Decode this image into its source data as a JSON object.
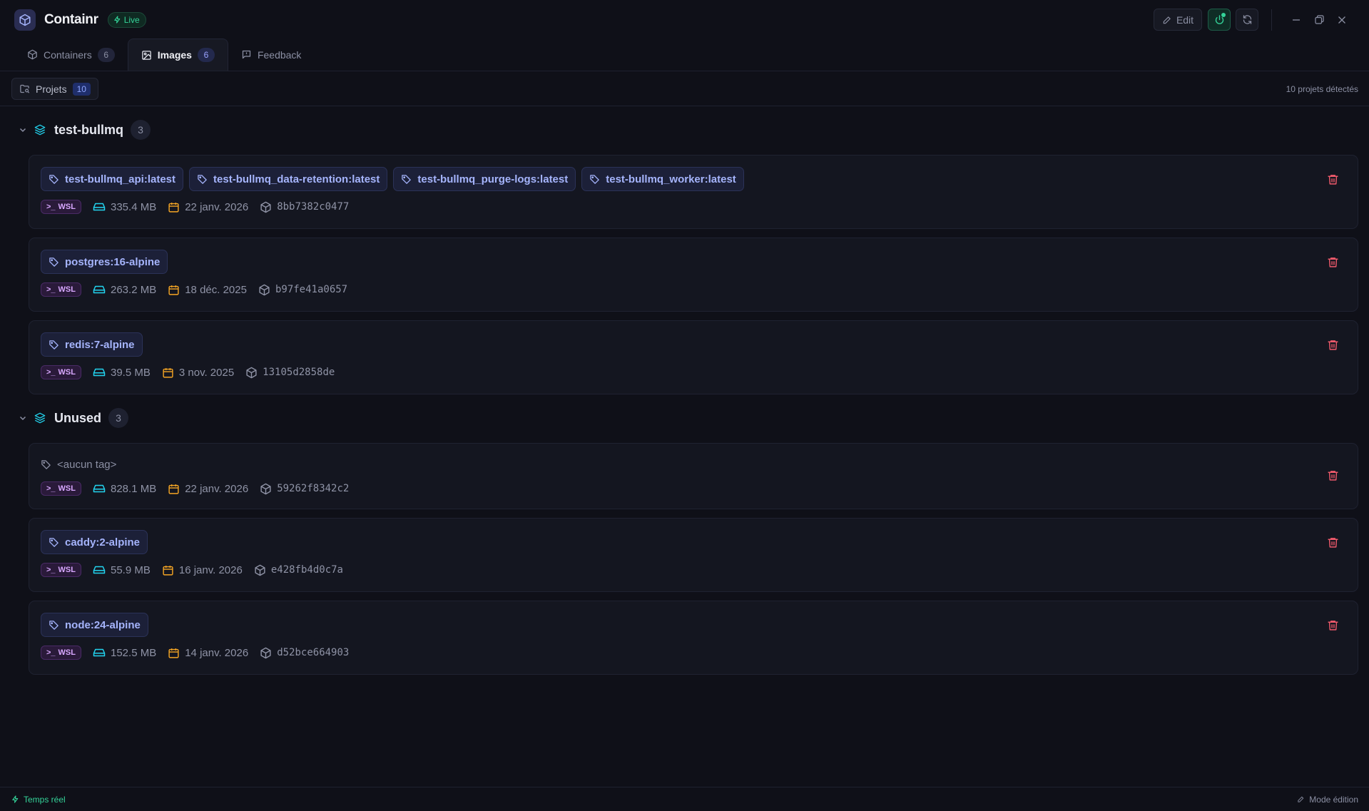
{
  "app": {
    "title": "Containr",
    "live_label": "Live",
    "edit_label": "Edit"
  },
  "tabs": [
    {
      "label": "Containers",
      "count": "6"
    },
    {
      "label": "Images",
      "count": "6"
    },
    {
      "label": "Feedback"
    }
  ],
  "subbar": {
    "projects_label": "Projets",
    "projects_count": "10",
    "detected_text": "10 projets détectés"
  },
  "groups": [
    {
      "name": "test-bullmq",
      "count": "3",
      "images": [
        {
          "tags": [
            "test-bullmq_api:latest",
            "test-bullmq_data-retention:latest",
            "test-bullmq_purge-logs:latest",
            "test-bullmq_worker:latest"
          ],
          "env": "WSL",
          "size": "335.4 MB",
          "date": "22 janv. 2026",
          "id": "8bb7382c0477"
        },
        {
          "tags": [
            "postgres:16-alpine"
          ],
          "env": "WSL",
          "size": "263.2 MB",
          "date": "18 déc. 2025",
          "id": "b97fe41a0657"
        },
        {
          "tags": [
            "redis:7-alpine"
          ],
          "env": "WSL",
          "size": "39.5 MB",
          "date": "3 nov. 2025",
          "id": "13105d2858de"
        }
      ]
    },
    {
      "name": "Unused",
      "count": "3",
      "images": [
        {
          "no_tag": "<aucun tag>",
          "env": "WSL",
          "size": "828.1 MB",
          "date": "22 janv. 2026",
          "id": "59262f8342c2"
        },
        {
          "tags": [
            "caddy:2-alpine"
          ],
          "env": "WSL",
          "size": "55.9 MB",
          "date": "16 janv. 2026",
          "id": "e428fb4d0c7a"
        },
        {
          "tags": [
            "node:24-alpine"
          ],
          "env": "WSL",
          "size": "152.5 MB",
          "date": "14 janv. 2026",
          "id": "d52bce664903"
        }
      ]
    }
  ],
  "footer": {
    "realtime_label": "Temps réel",
    "mode_label": "Mode édition"
  },
  "colors": {
    "accent": "#a5b4fc",
    "live": "#34d399",
    "storage_icon": "#22d3ee",
    "date_icon": "#f5a524",
    "trash": "#f05a6b",
    "wsl": "#d8a8ff"
  }
}
